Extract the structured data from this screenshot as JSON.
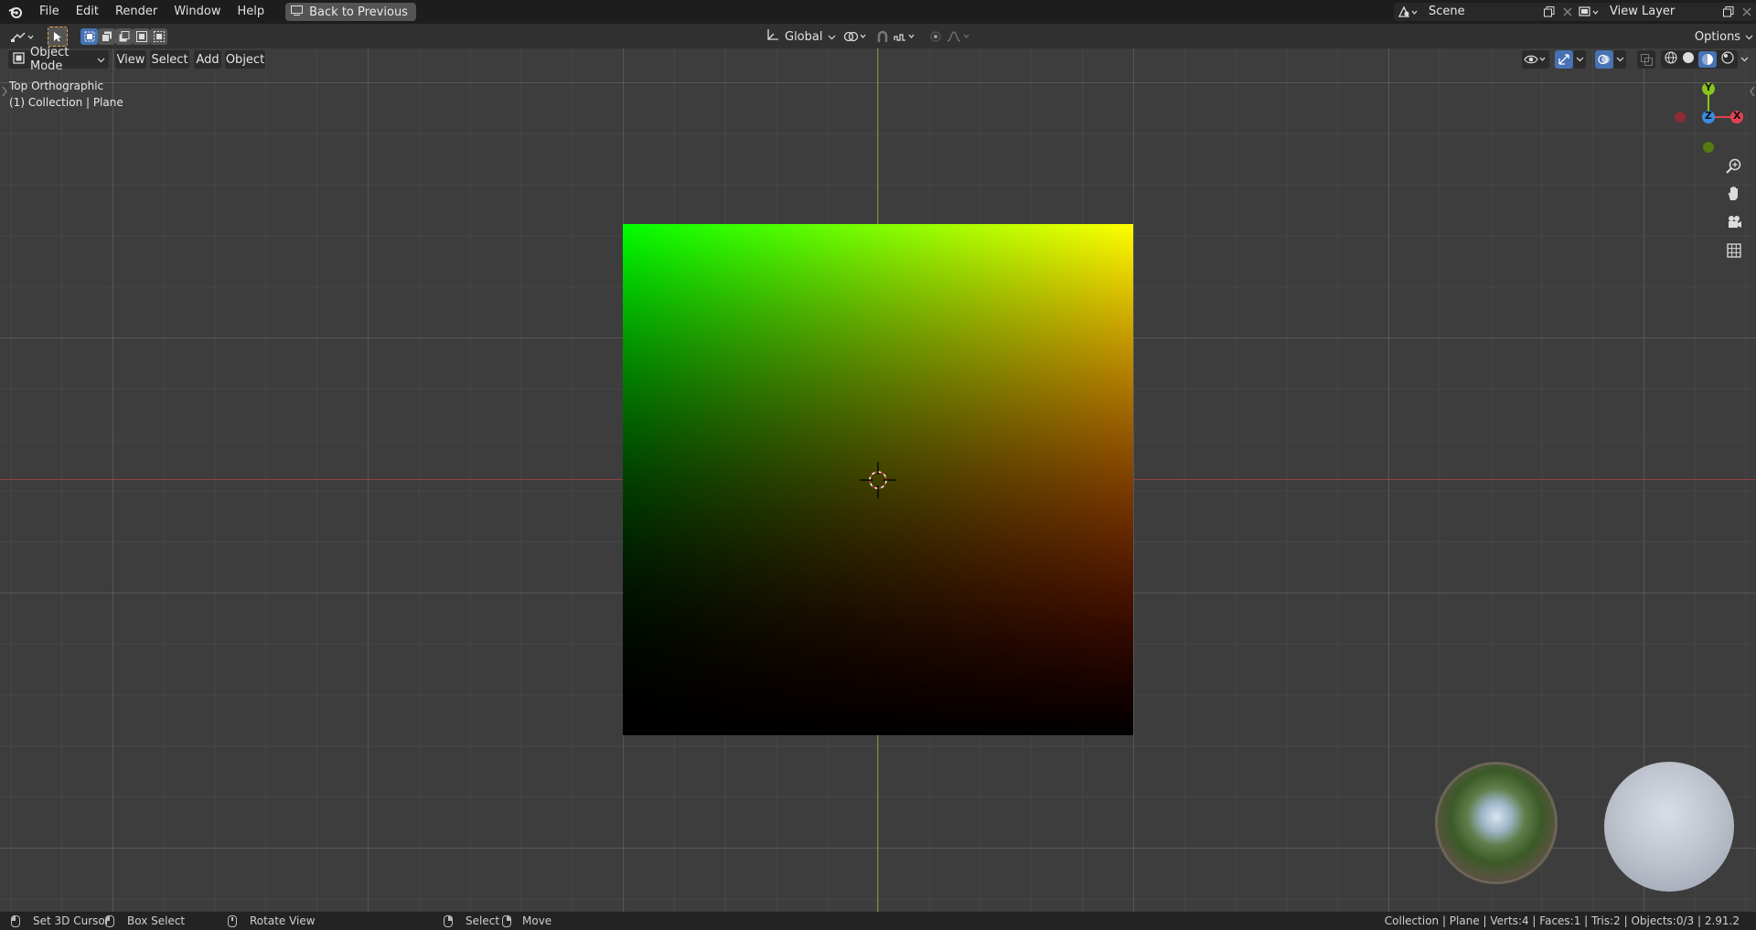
{
  "topbar": {
    "menus": [
      "File",
      "Edit",
      "Render",
      "Window",
      "Help"
    ],
    "back_button": "Back to Previous",
    "scene_name": "Scene",
    "view_layer": "View Layer"
  },
  "toolheader": {
    "transform_orientation": "Global",
    "options": "Options"
  },
  "viewheader": {
    "mode": "Object Mode",
    "menus": [
      "View",
      "Select",
      "Add",
      "Object"
    ]
  },
  "viewport": {
    "view_name": "Top Orthographic",
    "collection_info": "(1) Collection | Plane",
    "gizmo_labels": {
      "y": "Y",
      "z": "Z",
      "x": "X"
    }
  },
  "statusbar": {
    "set_cursor": "Set 3D Cursor",
    "box_select": "Box Select",
    "rotate_view": "Rotate View",
    "select": "Select",
    "move": "Move",
    "stats": "Collection | Plane | Verts:4 | Faces:1 | Tris:2 | Objects:0/3 | 2.91.2"
  },
  "colors": {
    "accent_blue": "#4772b3",
    "axis_x": "#e0424f",
    "axis_y": "#8ac41c",
    "axis_z": "#3b8de3"
  }
}
